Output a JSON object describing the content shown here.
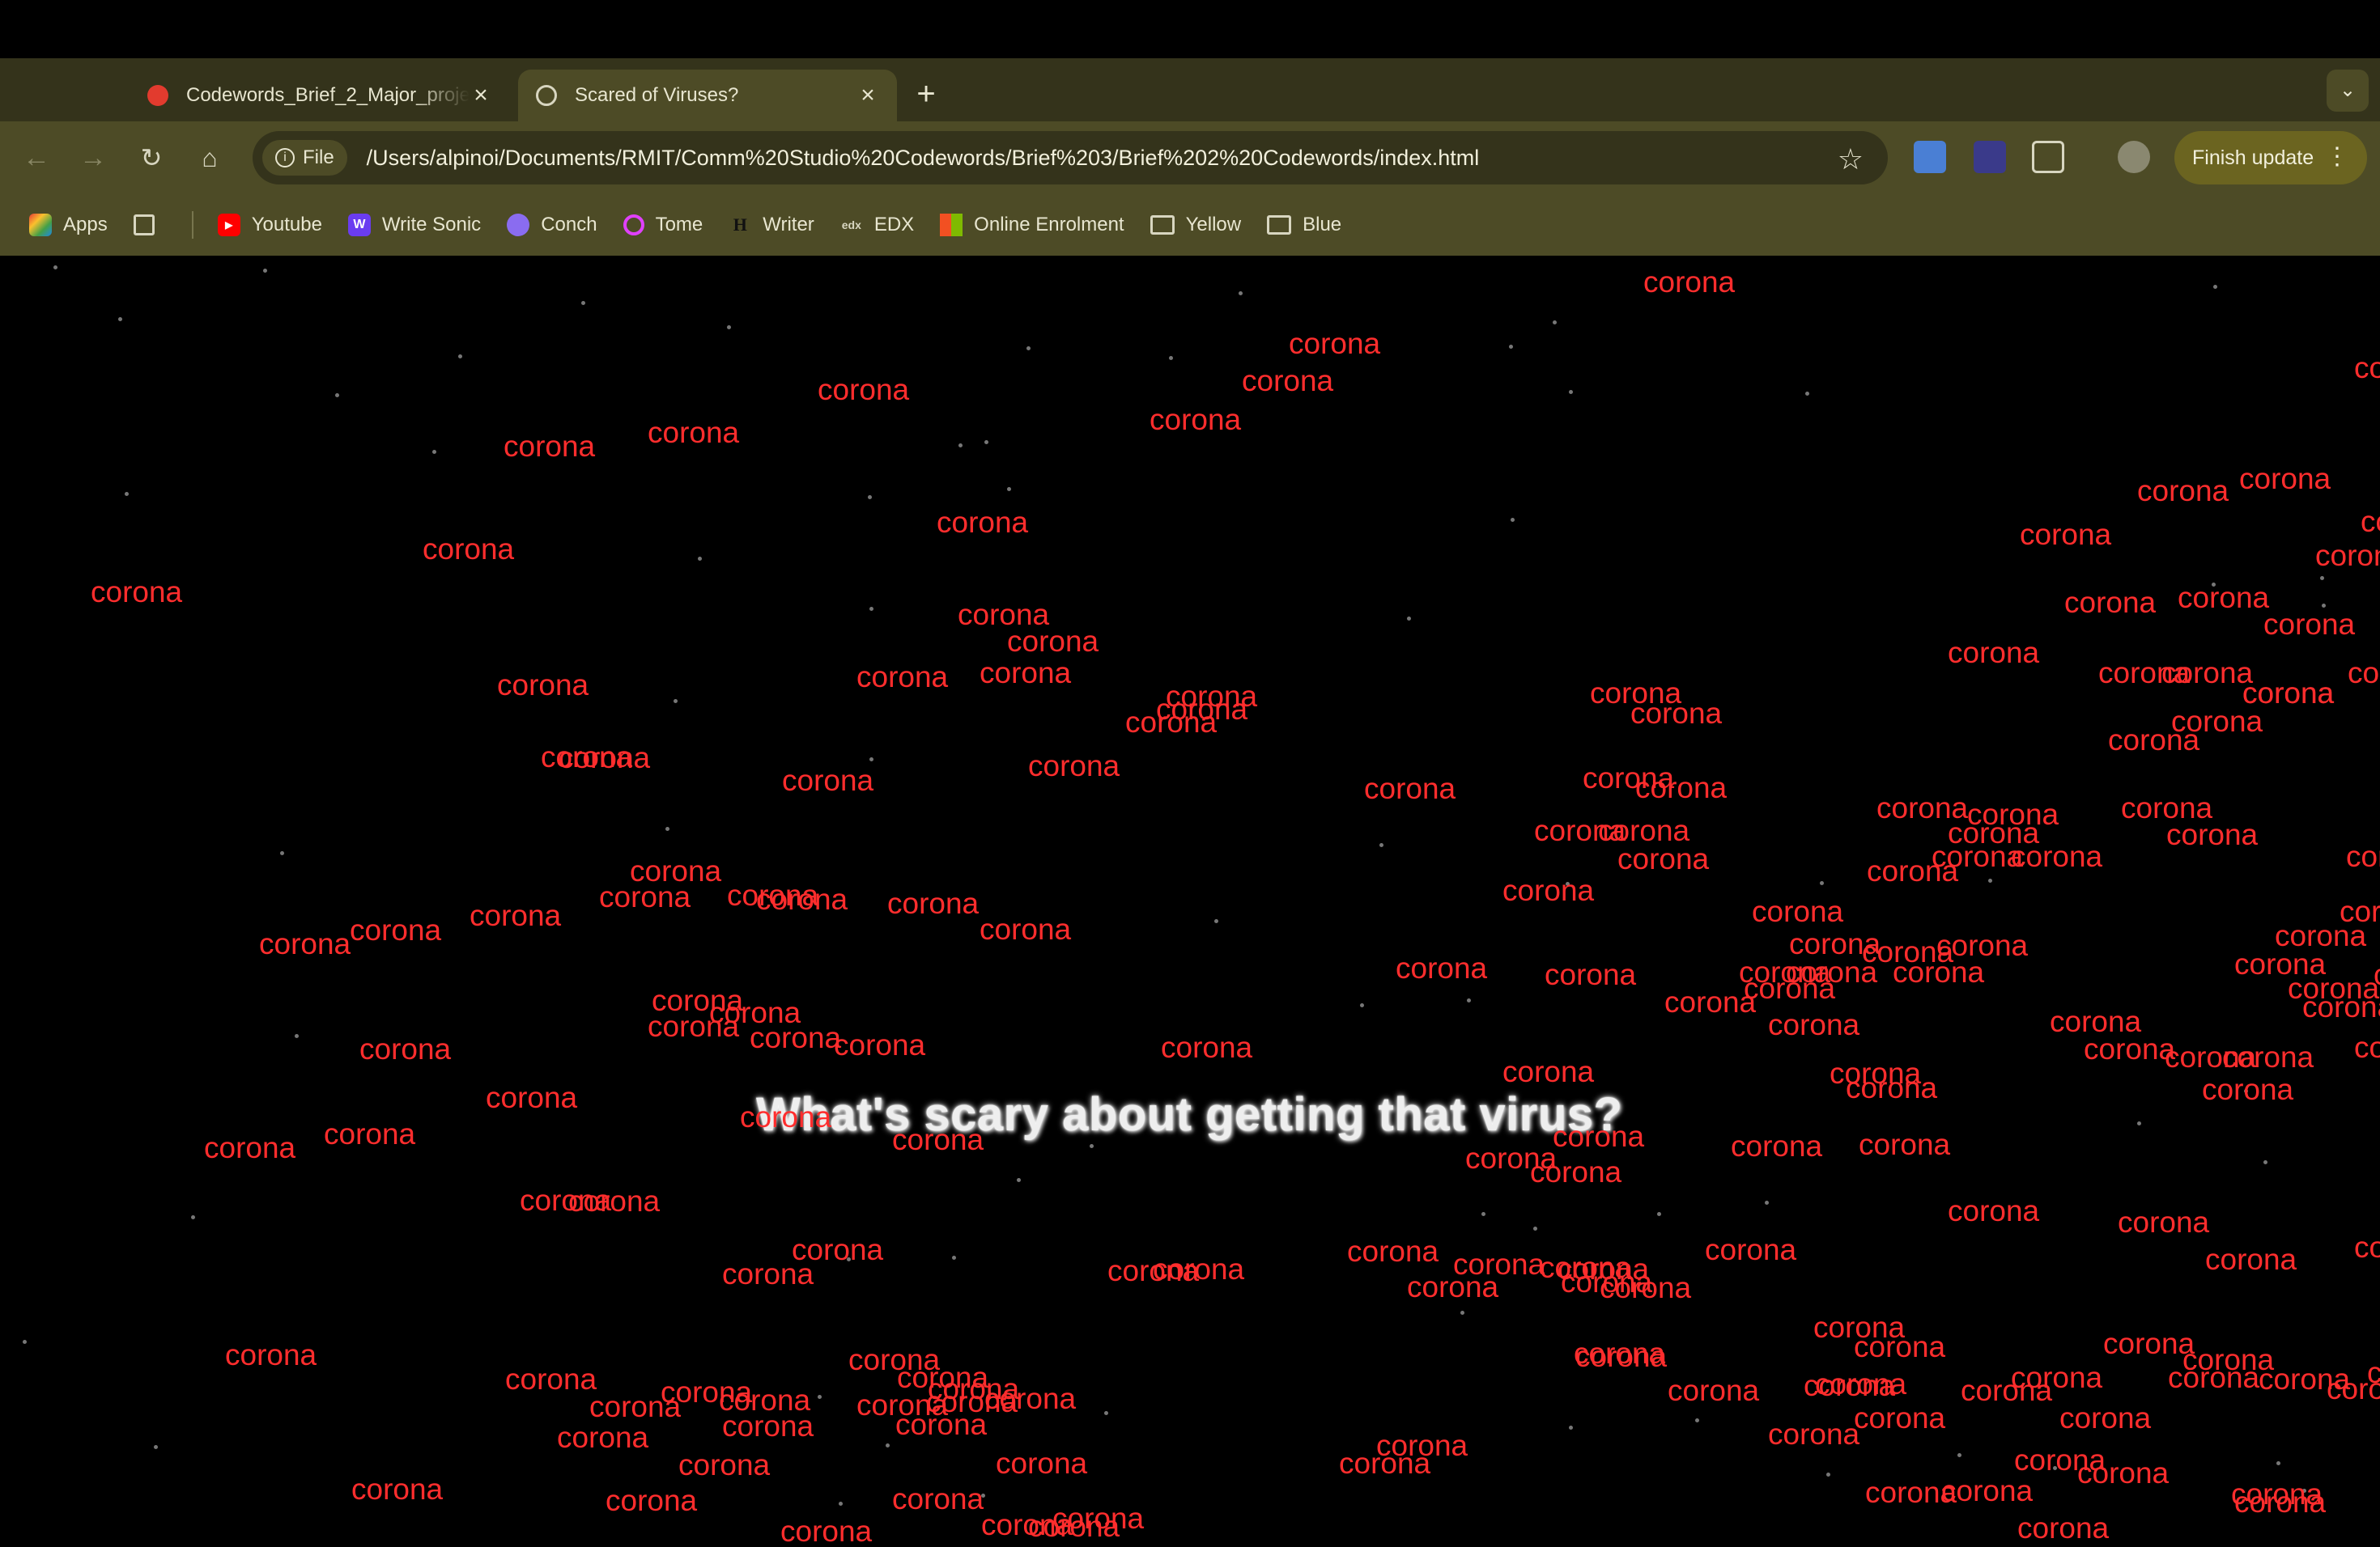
{
  "browser": {
    "tabs": [
      {
        "label": "Codewords_Brief_2_Major_project",
        "active": false
      },
      {
        "label": "Scared of Viruses?",
        "active": true
      }
    ],
    "address": {
      "scheme_chip": "File",
      "url": "/Users/alpinoi/Documents/RMIT/Comm%20Studio%20Codewords/Brief%203/Brief%202%20Codewords/index.html"
    },
    "finish_update_label": "Finish update",
    "bookmarks": [
      {
        "label": "Apps",
        "icon": "apps-grid-icon"
      },
      {
        "label": "Youtube",
        "icon": "youtube-icon",
        "color": "#ff0000"
      },
      {
        "label": "Write Sonic",
        "icon": "writesonic-icon",
        "color": "#6a3cf0"
      },
      {
        "label": "Conch",
        "icon": "conch-icon",
        "color": "#8a6cf0"
      },
      {
        "label": "Tome",
        "icon": "tome-icon",
        "color": "#e040fb"
      },
      {
        "label": "Writer",
        "icon": "writer-icon"
      },
      {
        "label": "EDX",
        "icon": "edx-icon"
      },
      {
        "label": "Online Enrolment",
        "icon": "microsoft-icon"
      },
      {
        "label": "Yellow",
        "icon": "folder-icon"
      },
      {
        "label": "Blue",
        "icon": "folder-icon"
      }
    ]
  },
  "page": {
    "question": "What's scary about getting that virus?",
    "word": "corona",
    "word_color": "#ff2d2d"
  }
}
